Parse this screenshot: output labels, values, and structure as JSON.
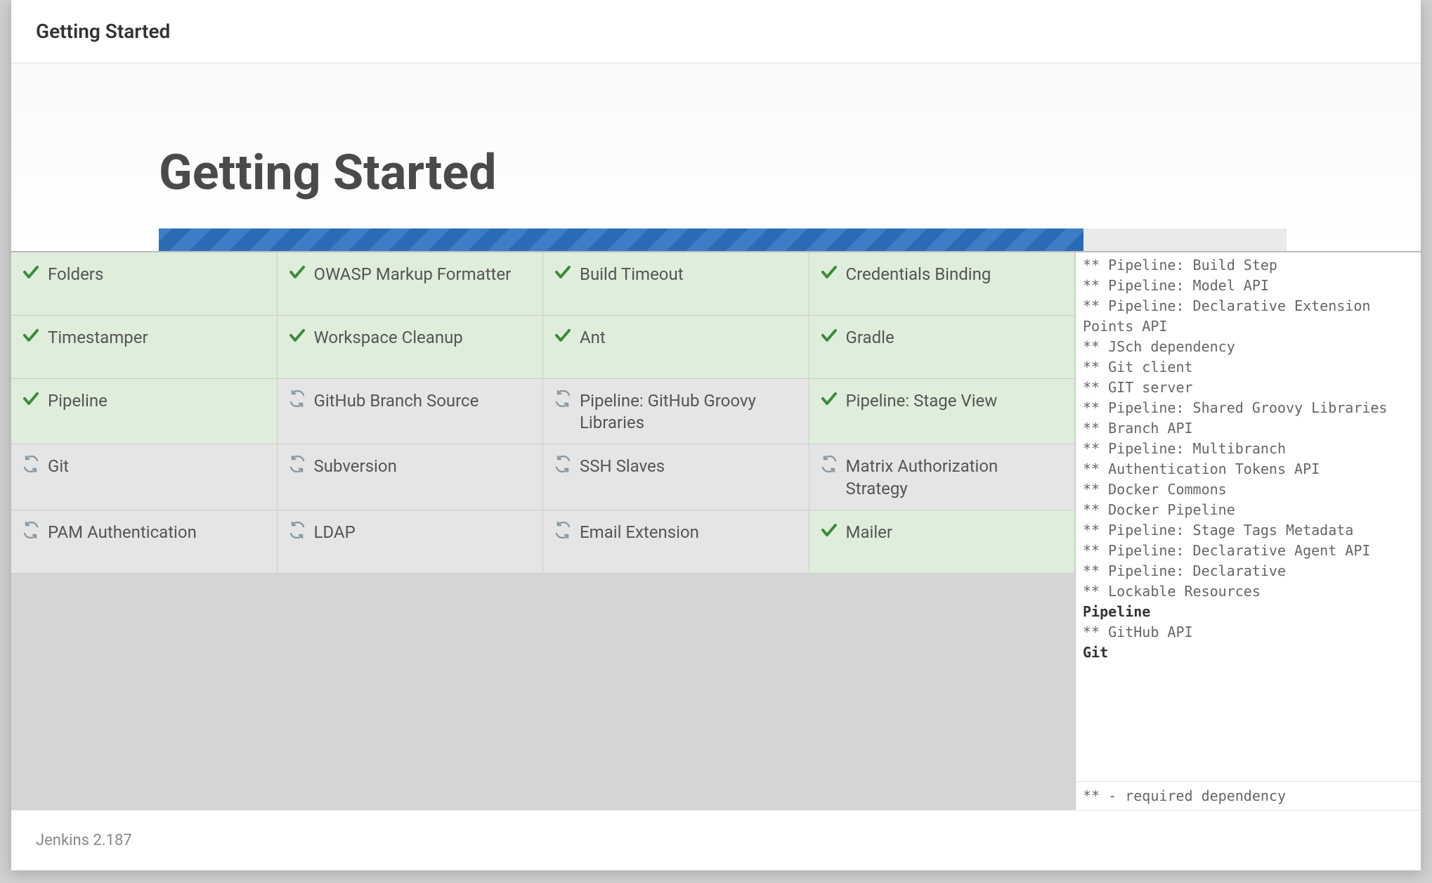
{
  "header": {
    "title": "Getting Started"
  },
  "hero": {
    "title": "Getting Started"
  },
  "progress": {
    "percent": 82
  },
  "plugins": [
    {
      "label": "Folders",
      "status": "done"
    },
    {
      "label": "OWASP Markup Formatter",
      "status": "done"
    },
    {
      "label": "Build Timeout",
      "status": "done"
    },
    {
      "label": "Credentials Binding",
      "status": "done"
    },
    {
      "label": "Timestamper",
      "status": "done"
    },
    {
      "label": "Workspace Cleanup",
      "status": "done"
    },
    {
      "label": "Ant",
      "status": "done"
    },
    {
      "label": "Gradle",
      "status": "done"
    },
    {
      "label": "Pipeline",
      "status": "done"
    },
    {
      "label": "GitHub Branch Source",
      "status": "pending"
    },
    {
      "label": "Pipeline: GitHub Groovy Libraries",
      "status": "pending"
    },
    {
      "label": "Pipeline: Stage View",
      "status": "done"
    },
    {
      "label": "Git",
      "status": "pending"
    },
    {
      "label": "Subversion",
      "status": "pending"
    },
    {
      "label": "SSH Slaves",
      "status": "pending"
    },
    {
      "label": "Matrix Authorization Strategy",
      "status": "pending"
    },
    {
      "label": "PAM Authentication",
      "status": "pending"
    },
    {
      "label": "LDAP",
      "status": "pending"
    },
    {
      "label": "Email Extension",
      "status": "pending"
    },
    {
      "label": "Mailer",
      "status": "done"
    }
  ],
  "log": {
    "lines": [
      {
        "text": "** Pipeline: Build Step",
        "bold": false
      },
      {
        "text": "** Pipeline: Model API",
        "bold": false
      },
      {
        "text": "** Pipeline: Declarative Extension Points API",
        "bold": false
      },
      {
        "text": "** JSch dependency",
        "bold": false
      },
      {
        "text": "** Git client",
        "bold": false
      },
      {
        "text": "** GIT server",
        "bold": false
      },
      {
        "text": "** Pipeline: Shared Groovy Libraries",
        "bold": false
      },
      {
        "text": "** Branch API",
        "bold": false
      },
      {
        "text": "** Pipeline: Multibranch",
        "bold": false
      },
      {
        "text": "** Authentication Tokens API",
        "bold": false
      },
      {
        "text": "** Docker Commons",
        "bold": false
      },
      {
        "text": "** Docker Pipeline",
        "bold": false
      },
      {
        "text": "** Pipeline: Stage Tags Metadata",
        "bold": false
      },
      {
        "text": "** Pipeline: Declarative Agent API",
        "bold": false
      },
      {
        "text": "** Pipeline: Declarative",
        "bold": false
      },
      {
        "text": "** Lockable Resources",
        "bold": false
      },
      {
        "text": "Pipeline",
        "bold": true
      },
      {
        "text": "** GitHub API",
        "bold": false
      },
      {
        "text": "Git",
        "bold": true
      }
    ],
    "footer": "** - required dependency"
  },
  "footer": {
    "version": "Jenkins 2.187"
  },
  "colors": {
    "check": "#3a8b3a",
    "spin": "#8a9aa5"
  }
}
